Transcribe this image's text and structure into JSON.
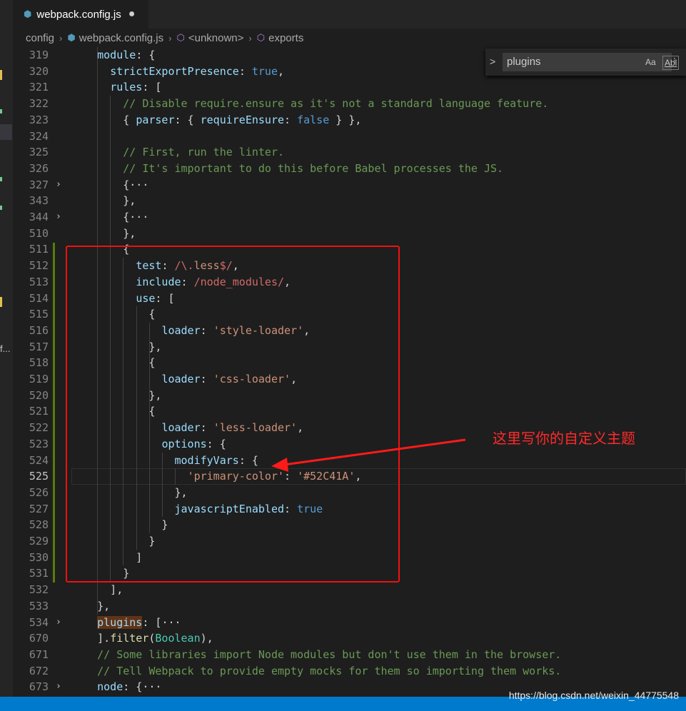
{
  "tab": {
    "title": "webpack.config.js",
    "dirty": "●",
    "icon": "js-file-icon"
  },
  "breadcrumb": {
    "items": [
      "config",
      "webpack.config.js",
      "<unknown>",
      "exports"
    ],
    "sep": "›"
  },
  "find": {
    "query": "plugins",
    "match_case": "Aa",
    "whole_word": "Abl",
    "more": "⁝"
  },
  "annotation": {
    "text": "这里写你的自定义主题",
    "color": "#ff2a2a"
  },
  "watermark": "https://blog.csdn.net/weixin_44775548",
  "lines": [
    {
      "n": "319",
      "segs": [
        [
          "    ",
          "e"
        ],
        [
          "module",
          "k"
        ],
        [
          ": {",
          "e"
        ]
      ]
    },
    {
      "n": "320",
      "segs": [
        [
          "      ",
          "e"
        ],
        [
          "strictExportPresence",
          "k"
        ],
        [
          ": ",
          "e"
        ],
        [
          "true",
          "b"
        ],
        [
          ",",
          "e"
        ]
      ]
    },
    {
      "n": "321",
      "segs": [
        [
          "      ",
          "e"
        ],
        [
          "rules",
          "k"
        ],
        [
          ": [",
          "e"
        ]
      ]
    },
    {
      "n": "322",
      "segs": [
        [
          "        ",
          "e"
        ],
        [
          "// Disable require.ensure as it's not a standard language feature.",
          "c"
        ]
      ]
    },
    {
      "n": "323",
      "segs": [
        [
          "        { ",
          "e"
        ],
        [
          "parser",
          "k"
        ],
        [
          ": { ",
          "e"
        ],
        [
          "requireEnsure",
          "k"
        ],
        [
          ": ",
          "e"
        ],
        [
          "false",
          "b"
        ],
        [
          " } },",
          "e"
        ]
      ]
    },
    {
      "n": "324",
      "segs": []
    },
    {
      "n": "325",
      "segs": [
        [
          "        ",
          "e"
        ],
        [
          "// First, run the linter.",
          "c"
        ]
      ]
    },
    {
      "n": "326",
      "segs": [
        [
          "        ",
          "e"
        ],
        [
          "// It's important to do this before Babel processes the JS.",
          "c"
        ]
      ]
    },
    {
      "n": "327",
      "fold": "›",
      "segs": [
        [
          "        {",
          "e"
        ],
        [
          "···",
          "e"
        ]
      ]
    },
    {
      "n": "343",
      "segs": [
        [
          "        },",
          "e"
        ]
      ]
    },
    {
      "n": "344",
      "fold": "›",
      "segs": [
        [
          "        {",
          "e"
        ],
        [
          "···",
          "e"
        ]
      ]
    },
    {
      "n": "510",
      "segs": [
        [
          "        },",
          "e"
        ]
      ]
    },
    {
      "n": "511",
      "segs": [
        [
          "        {",
          "e"
        ]
      ]
    },
    {
      "n": "512",
      "segs": [
        [
          "          ",
          "e"
        ],
        [
          "test",
          "k"
        ],
        [
          ": ",
          "e"
        ],
        [
          "/\\.",
          "r"
        ],
        [
          "less",
          "s"
        ],
        [
          "$/",
          "r"
        ],
        [
          ",",
          "e"
        ]
      ]
    },
    {
      "n": "513",
      "segs": [
        [
          "          ",
          "e"
        ],
        [
          "include",
          "k"
        ],
        [
          ": ",
          "e"
        ],
        [
          "/node_modules/",
          "r"
        ],
        [
          ",",
          "e"
        ]
      ]
    },
    {
      "n": "514",
      "segs": [
        [
          "          ",
          "e"
        ],
        [
          "use",
          "k"
        ],
        [
          ": [",
          "e"
        ]
      ]
    },
    {
      "n": "515",
      "segs": [
        [
          "            {",
          "e"
        ]
      ]
    },
    {
      "n": "516",
      "segs": [
        [
          "              ",
          "e"
        ],
        [
          "loader",
          "k"
        ],
        [
          ": ",
          "e"
        ],
        [
          "'style-loader'",
          "s"
        ],
        [
          ",",
          "e"
        ]
      ]
    },
    {
      "n": "517",
      "segs": [
        [
          "            },",
          "e"
        ]
      ]
    },
    {
      "n": "518",
      "segs": [
        [
          "            {",
          "e"
        ]
      ]
    },
    {
      "n": "519",
      "segs": [
        [
          "              ",
          "e"
        ],
        [
          "loader",
          "k"
        ],
        [
          ": ",
          "e"
        ],
        [
          "'css-loader'",
          "s"
        ],
        [
          ",",
          "e"
        ]
      ]
    },
    {
      "n": "520",
      "segs": [
        [
          "            },",
          "e"
        ]
      ]
    },
    {
      "n": "521",
      "segs": [
        [
          "            {",
          "e"
        ]
      ]
    },
    {
      "n": "522",
      "segs": [
        [
          "              ",
          "e"
        ],
        [
          "loader",
          "k"
        ],
        [
          ": ",
          "e"
        ],
        [
          "'less-loader'",
          "s"
        ],
        [
          ",",
          "e"
        ]
      ]
    },
    {
      "n": "523",
      "segs": [
        [
          "              ",
          "e"
        ],
        [
          "options",
          "k"
        ],
        [
          ": {",
          "e"
        ]
      ]
    },
    {
      "n": "524",
      "segs": [
        [
          "                ",
          "e"
        ],
        [
          "modifyVars",
          "k"
        ],
        [
          ": {",
          "e"
        ]
      ]
    },
    {
      "n": "525",
      "cur": true,
      "segs": [
        [
          "                  ",
          "e"
        ],
        [
          "'primary-color'",
          "s"
        ],
        [
          ": ",
          "e"
        ],
        [
          "'#52C41A'",
          "s"
        ],
        [
          ",",
          "e"
        ]
      ]
    },
    {
      "n": "526",
      "segs": [
        [
          "                },",
          "e"
        ]
      ]
    },
    {
      "n": "527",
      "segs": [
        [
          "                ",
          "e"
        ],
        [
          "javascriptEnabled",
          "k"
        ],
        [
          ": ",
          "e"
        ],
        [
          "true",
          "b"
        ]
      ]
    },
    {
      "n": "528",
      "segs": [
        [
          "              }",
          "e"
        ]
      ]
    },
    {
      "n": "529",
      "segs": [
        [
          "            }",
          "e"
        ]
      ]
    },
    {
      "n": "530",
      "segs": [
        [
          "          ]",
          "e"
        ]
      ]
    },
    {
      "n": "531",
      "segs": [
        [
          "        }",
          "e"
        ]
      ]
    },
    {
      "n": "532",
      "segs": [
        [
          "      ],",
          "e"
        ]
      ]
    },
    {
      "n": "533",
      "segs": [
        [
          "    },",
          "e"
        ]
      ]
    },
    {
      "n": "534",
      "fold": "›",
      "segs": [
        [
          "    ",
          "e"
        ],
        [
          "plugins",
          "k",
          "hl"
        ],
        [
          ": [",
          "e"
        ],
        [
          "···",
          "e"
        ]
      ]
    },
    {
      "n": "670",
      "segs": [
        [
          "    ].",
          "e"
        ],
        [
          "filter",
          "y"
        ],
        [
          "(",
          "e"
        ],
        [
          "Boolean",
          "t"
        ],
        [
          "),",
          "e"
        ]
      ]
    },
    {
      "n": "671",
      "segs": [
        [
          "    ",
          "e"
        ],
        [
          "// Some libraries import Node modules but don't use them in the browser.",
          "c"
        ]
      ]
    },
    {
      "n": "672",
      "segs": [
        [
          "    ",
          "e"
        ],
        [
          "// Tell Webpack to provide empty mocks for them so importing them works.",
          "c"
        ]
      ]
    },
    {
      "n": "673",
      "fold": "›",
      "segs": [
        [
          "    ",
          "e"
        ],
        [
          "node",
          "k"
        ],
        [
          ": {",
          "e"
        ],
        [
          "···",
          "e"
        ]
      ]
    }
  ]
}
